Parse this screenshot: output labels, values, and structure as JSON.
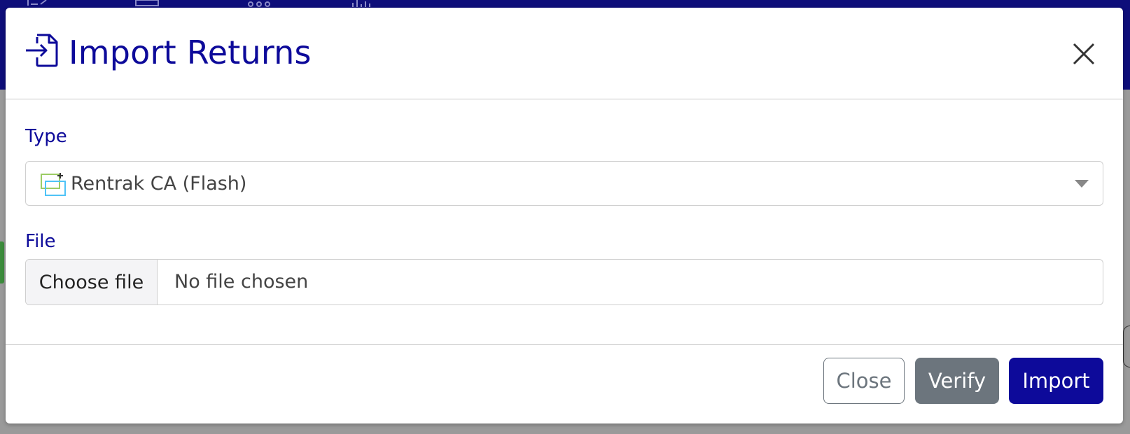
{
  "modal": {
    "title": "Import Returns",
    "header_icon": "file-import-icon",
    "close_icon": "close-icon"
  },
  "form": {
    "type_label": "Type",
    "type_selected": "Rentrak CA (Flash)",
    "type_icon": "rentrak-ca-icon",
    "file_label": "File",
    "file_button_label": "Choose file",
    "file_status": "No file chosen"
  },
  "footer": {
    "close_label": "Close",
    "verify_label": "Verify",
    "import_label": "Import"
  },
  "colors": {
    "brand": "#0d0a9a",
    "secondary": "#6c757d",
    "topbar": "#0e0e7a"
  }
}
